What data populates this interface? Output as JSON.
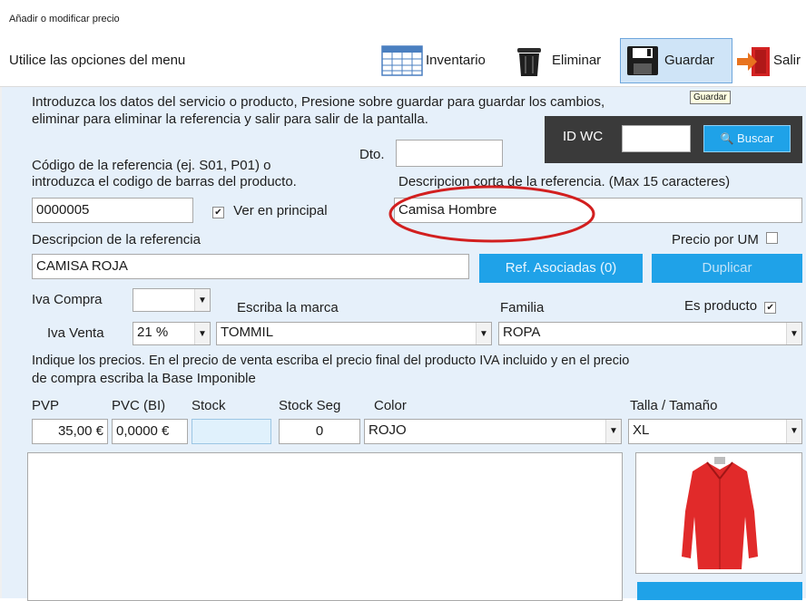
{
  "window": {
    "title": "Añadir o modificar precio"
  },
  "toolbar": {
    "hint": "Utilice las opciones del menu",
    "inventario_label": "Inventario",
    "eliminar_label": "Eliminar",
    "guardar_label": "Guardar",
    "salir_label": "Salir",
    "tooltip": "Guardar"
  },
  "intro": {
    "line1": "Introduzca los datos del servicio o producto, Presione sobre guardar para guardar los cambios,",
    "line2": "eliminar para eliminar la referencia y salir para salir de la pantalla."
  },
  "idwc": {
    "label": "ID WC",
    "value": "",
    "search_label": "Buscar"
  },
  "form": {
    "dto_label": "Dto.",
    "dto_value": "",
    "codigo_label_1": "Código de la referencia (ej. S01, P01) o",
    "codigo_label_2": "introduzca el codigo de barras del producto.",
    "codigo_value": "0000005",
    "ver_principal_label": "Ver en principal",
    "ver_principal_checked": true,
    "desc_corta_label": "Descripcion corta de la referencia. (Max 15 caracteres)",
    "desc_corta_value": "Camisa Hombre",
    "desc_label": "Descripcion de la referencia",
    "desc_value": "CAMISA ROJA",
    "precio_um_label": "Precio por UM",
    "precio_um_checked": false,
    "ref_asociadas_label": "Ref. Asociadas (0)",
    "duplicar_label": "Duplicar",
    "iva_compra_label": "Iva Compra",
    "iva_compra_value": "",
    "iva_venta_label": "Iva Venta",
    "iva_venta_value": "21 %",
    "marca_label": "Escriba la marca",
    "marca_value": "TOMMIL",
    "familia_label": "Familia",
    "familia_value": "ROPA",
    "es_producto_label": "Es producto",
    "es_producto_checked": true,
    "precios_info_1": "Indique los precios. En el precio de venta escriba el precio final del producto IVA incluido y en el precio",
    "precios_info_2": "de compra escriba la Base Imponible",
    "pvp_label": "PVP",
    "pvp_value": "35,00 €",
    "pvc_label": "PVC (BI)",
    "pvc_value": "0,0000 €",
    "stock_label": "Stock",
    "stock_value": "",
    "stock_seg_label": "Stock Seg",
    "stock_seg_value": "0",
    "color_label": "Color",
    "color_value": "ROJO",
    "talla_label": "Talla / Tamaño",
    "talla_value": "XL"
  },
  "colors": {
    "accent": "#1fa2e8",
    "annotation": "#d21f1f",
    "panel": "#e6f0fa"
  }
}
